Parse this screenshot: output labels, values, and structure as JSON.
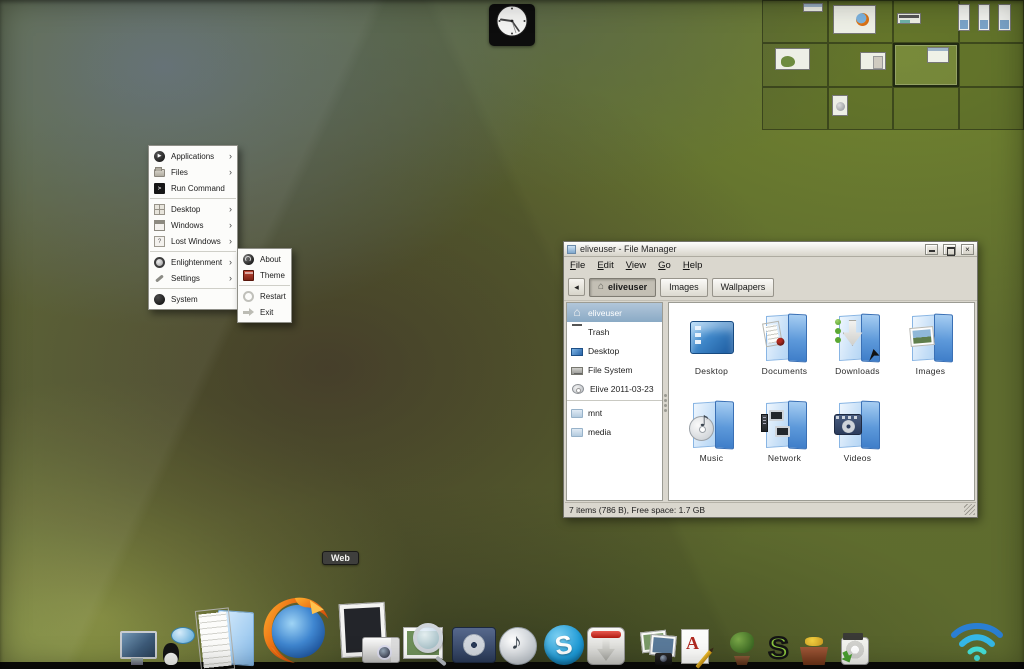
{
  "desktop": {
    "clock_icon": "analog-clock",
    "wifi_icon": "wifi-signal",
    "wallpaper_colors": {
      "slate": "#64727b",
      "brown": "#4a4130",
      "yellow_green": "#99a44d",
      "olive": "#5f6d2f"
    }
  },
  "pager": {
    "columns": 4,
    "rows": 3,
    "active_cell": {
      "row": 2,
      "col": 3
    }
  },
  "menu": {
    "arrow": "›",
    "items": [
      {
        "label": "Applications",
        "icon": "applications-icon",
        "submenu": true
      },
      {
        "label": "Files",
        "icon": "files-icon",
        "submenu": true
      },
      {
        "label": "Run Command",
        "icon": "terminal-icon",
        "submenu": false
      },
      {
        "label": "Desktop",
        "icon": "desktop-icon",
        "submenu": true
      },
      {
        "label": "Windows",
        "icon": "windows-icon",
        "submenu": true
      },
      {
        "label": "Lost Windows",
        "icon": "lost-windows-icon",
        "submenu": true
      },
      {
        "label": "Enlightenment",
        "icon": "enlightenment-icon",
        "submenu": true
      },
      {
        "label": "Settings",
        "icon": "settings-icon",
        "submenu": true
      },
      {
        "label": "System",
        "icon": "system-icon",
        "submenu": false
      }
    ],
    "submenu_items": [
      {
        "label": "About",
        "icon": "about-icon"
      },
      {
        "label": "Theme",
        "icon": "theme-icon"
      },
      {
        "label": "Restart",
        "icon": "restart-icon"
      },
      {
        "label": "Exit",
        "icon": "exit-icon"
      }
    ]
  },
  "file_manager": {
    "title": "eliveuser - File Manager",
    "window_buttons": {
      "close_glyph": "×"
    },
    "menubar": [
      "File",
      "Edit",
      "View",
      "Go",
      "Help"
    ],
    "toolbar": {
      "back_glyph": "◂",
      "path": [
        {
          "label": "eliveuser",
          "current": true
        },
        {
          "label": "Images",
          "current": false
        },
        {
          "label": "Wallpapers",
          "current": false
        }
      ]
    },
    "sidebar": [
      "eliveuser",
      "Trash",
      "Desktop",
      "File System",
      "Elive 2011-03-23",
      "mnt",
      "media"
    ],
    "files": [
      "Desktop",
      "Documents",
      "Downloads",
      "Images",
      "Music",
      "Network",
      "Videos"
    ],
    "statusbar": "7 items (786 B), Free space: 1.7 GB"
  },
  "dock": {
    "tooltip": "Web",
    "items": [
      "monitor-terminal",
      "penguin-chat",
      "documents-folder",
      "firefox-browser",
      "photo-camera",
      "image-viewer",
      "video-player",
      "music-cd",
      "skype",
      "transmission",
      "photo-gallery",
      "office-writer",
      "bonsai",
      "scribus",
      "package-manager",
      "installer"
    ],
    "skype_letter": "S",
    "scribus_letter": "S",
    "office_letter": "A"
  },
  "glyphs": {
    "music_note": "♪",
    "home": "⌂",
    "question": "?",
    "prompt": ">",
    "play": "▶"
  }
}
